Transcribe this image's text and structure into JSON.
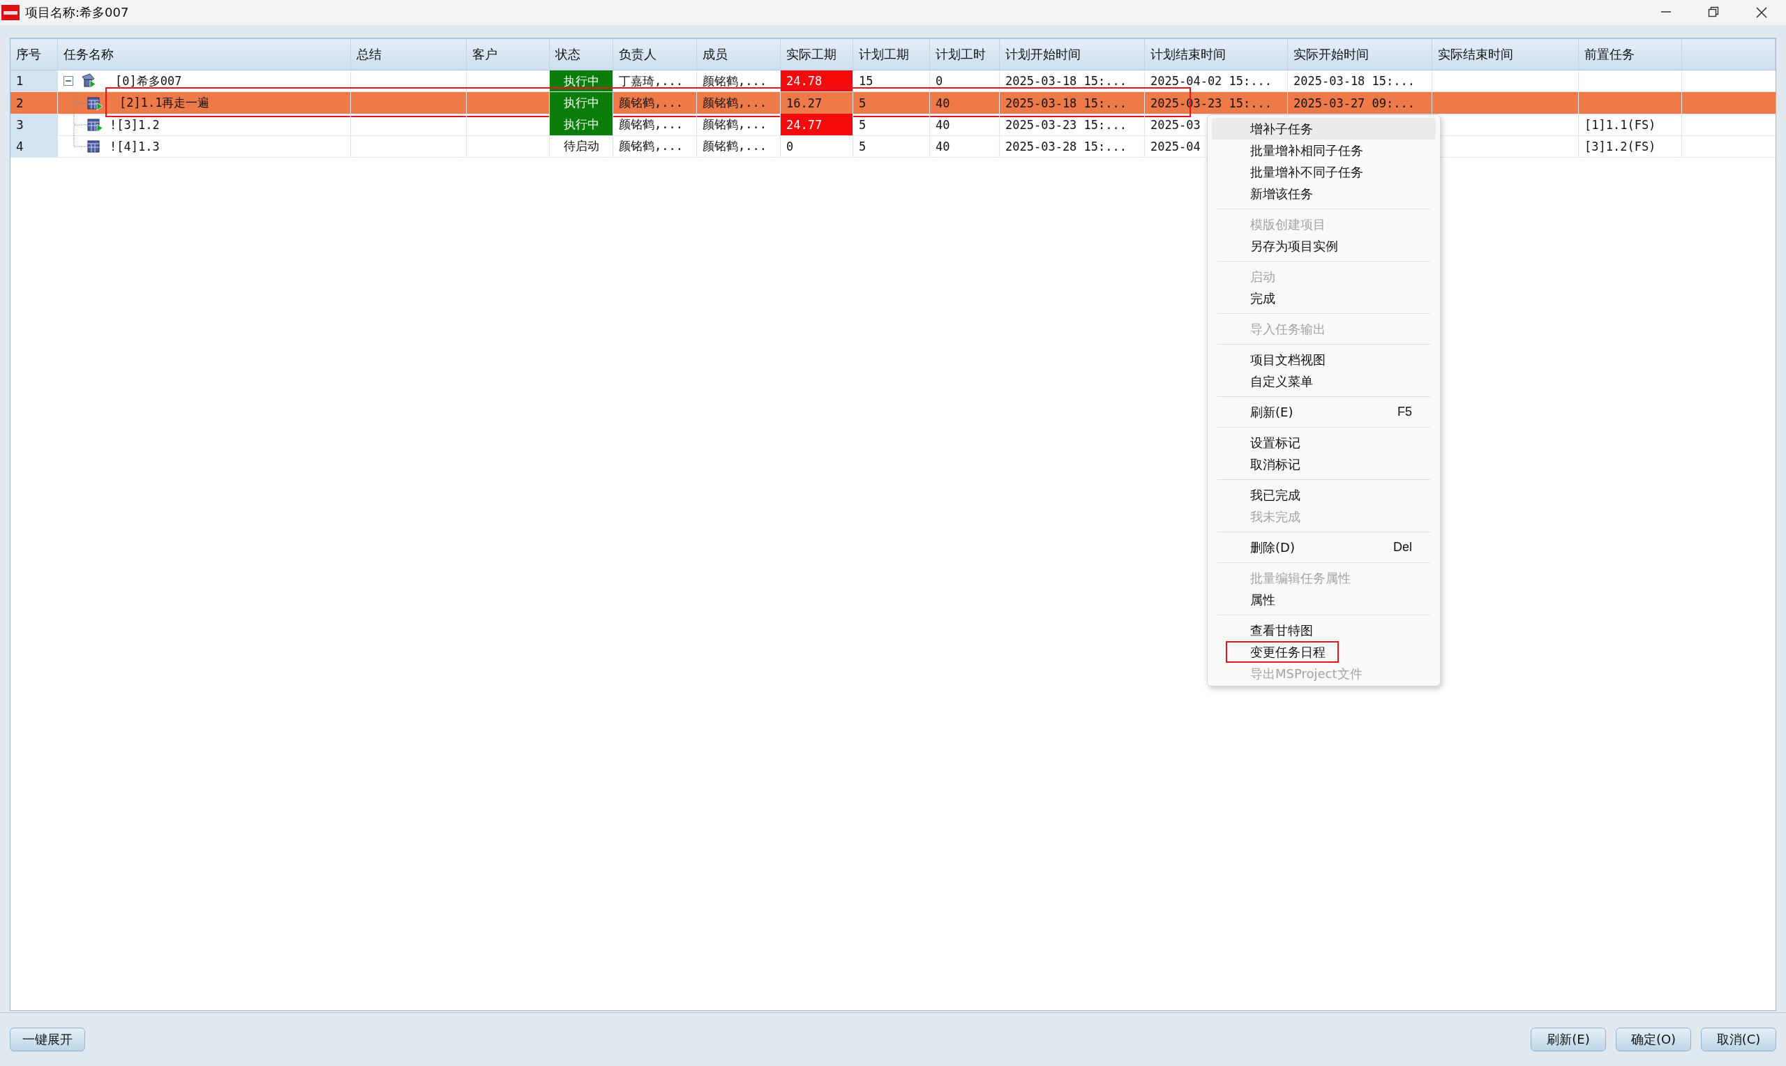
{
  "window": {
    "title": "项目名称:希多007"
  },
  "table": {
    "columns": [
      "序号",
      "任务名称",
      "总结",
      "客户",
      "状态",
      "负责人",
      "成员",
      "实际工期",
      "计划工期",
      "计划工时",
      "计划开始时间",
      "计划结束时间",
      "实际开始时间",
      "实际结束时间",
      "前置任务"
    ],
    "tasks": [
      {
        "no": "1",
        "name": "[0]希多007",
        "kind": "project",
        "expanded": true,
        "selected": false,
        "marked": false,
        "status": "执行中",
        "status_active": true,
        "owner": "丁嘉琦,...",
        "members": "颜铭鹤,...",
        "actual_duration": "24.78",
        "overdue": true,
        "plan_duration": "15",
        "plan_hours": "0",
        "plan_start": "2025-03-18 15:...",
        "plan_end": "2025-04-02 15:...",
        "actual_start": "2025-03-18 15:...",
        "children": [
          {
            "no": "2",
            "name": "[2]1.1再走一遍",
            "kind": "task",
            "selected": true,
            "marked": true,
            "status": "执行中",
            "status_active": true,
            "owner": "颜铭鹤,...",
            "members": "颜铭鹤,...",
            "actual_duration": "16.27",
            "overdue": false,
            "plan_duration": "5",
            "plan_hours": "40",
            "plan_start": "2025-03-18 15:...",
            "plan_end": "2025-03-23 15:...",
            "actual_start": "2025-03-27 09:..."
          },
          {
            "no": "3",
            "name": "![3]1.2",
            "kind": "task",
            "selected": false,
            "marked": false,
            "status": "执行中",
            "status_active": true,
            "owner": "颜铭鹤,...",
            "members": "颜铭鹤,...",
            "actual_duration": "24.77",
            "overdue": true,
            "plan_duration": "5",
            "plan_hours": "40",
            "plan_start": "2025-03-23 15:...",
            "plan_end": "2025-03",
            "predecessor": "[1]1.1(FS)"
          },
          {
            "no": "4",
            "name": "![4]1.3",
            "kind": "task",
            "selected": false,
            "marked": false,
            "status": "待启动",
            "status_active": false,
            "owner": "颜铭鹤,...",
            "members": "颜铭鹤,...",
            "actual_duration": "0",
            "overdue": false,
            "plan_duration": "5",
            "plan_hours": "40",
            "plan_start": "2025-03-28 15:...",
            "plan_end": "2025-04",
            "predecessor": "[3]1.2(FS)"
          }
        ]
      }
    ]
  },
  "context_menu": {
    "items": [
      {
        "kind": "item",
        "label": "增补子任务",
        "disabled": false,
        "selected": true,
        "marked": false
      },
      {
        "kind": "item",
        "label": "批量增补相同子任务",
        "disabled": false,
        "selected": false,
        "marked": false
      },
      {
        "kind": "item",
        "label": "批量增补不同子任务",
        "disabled": false,
        "selected": false,
        "marked": false
      },
      {
        "kind": "item",
        "label": "新增该任务",
        "disabled": false,
        "selected": false,
        "marked": false
      },
      {
        "kind": "separator"
      },
      {
        "kind": "item",
        "label": "模版创建项目",
        "disabled": true,
        "selected": false,
        "marked": false
      },
      {
        "kind": "item",
        "label": "另存为项目实例",
        "disabled": false,
        "selected": false,
        "marked": false
      },
      {
        "kind": "separator"
      },
      {
        "kind": "item",
        "label": "启动",
        "disabled": true,
        "selected": false,
        "marked": false
      },
      {
        "kind": "item",
        "label": "完成",
        "disabled": false,
        "selected": false,
        "marked": false
      },
      {
        "kind": "separator"
      },
      {
        "kind": "item",
        "label": "导入任务输出",
        "disabled": true,
        "selected": false,
        "marked": false
      },
      {
        "kind": "separator"
      },
      {
        "kind": "item",
        "label": "项目文档视图",
        "disabled": false,
        "selected": false,
        "marked": false
      },
      {
        "kind": "item",
        "label": "自定义菜单",
        "disabled": false,
        "selected": false,
        "marked": false
      },
      {
        "kind": "separator"
      },
      {
        "kind": "item",
        "label": "刷新(E)",
        "shortcut": "F5",
        "disabled": false,
        "selected": false,
        "marked": false
      },
      {
        "kind": "separator"
      },
      {
        "kind": "item",
        "label": "设置标记",
        "disabled": false,
        "selected": false,
        "marked": false
      },
      {
        "kind": "item",
        "label": "取消标记",
        "disabled": false,
        "selected": false,
        "marked": false
      },
      {
        "kind": "separator"
      },
      {
        "kind": "item",
        "label": "我已完成",
        "disabled": false,
        "selected": false,
        "marked": false
      },
      {
        "kind": "item",
        "label": "我未完成",
        "disabled": true,
        "selected": false,
        "marked": false
      },
      {
        "kind": "separator"
      },
      {
        "kind": "item",
        "label": "删除(D)",
        "shortcut": "Del",
        "disabled": false,
        "selected": false,
        "marked": false
      },
      {
        "kind": "separator"
      },
      {
        "kind": "item",
        "label": "批量编辑任务属性",
        "disabled": true,
        "selected": false,
        "marked": false
      },
      {
        "kind": "item",
        "label": "属性",
        "disabled": false,
        "selected": false,
        "marked": false
      },
      {
        "kind": "separator"
      },
      {
        "kind": "item",
        "label": "查看甘特图",
        "disabled": false,
        "selected": false,
        "marked": false
      },
      {
        "kind": "item",
        "label": "变更任务日程",
        "disabled": false,
        "selected": false,
        "marked": true
      },
      {
        "kind": "item",
        "label": "导出MSProject文件",
        "disabled": true,
        "selected": false,
        "marked": false
      }
    ]
  },
  "footer": {
    "left_button": "一键展开",
    "buttons": [
      "刷新(E)",
      "确定(O)",
      "取消(C)"
    ]
  }
}
